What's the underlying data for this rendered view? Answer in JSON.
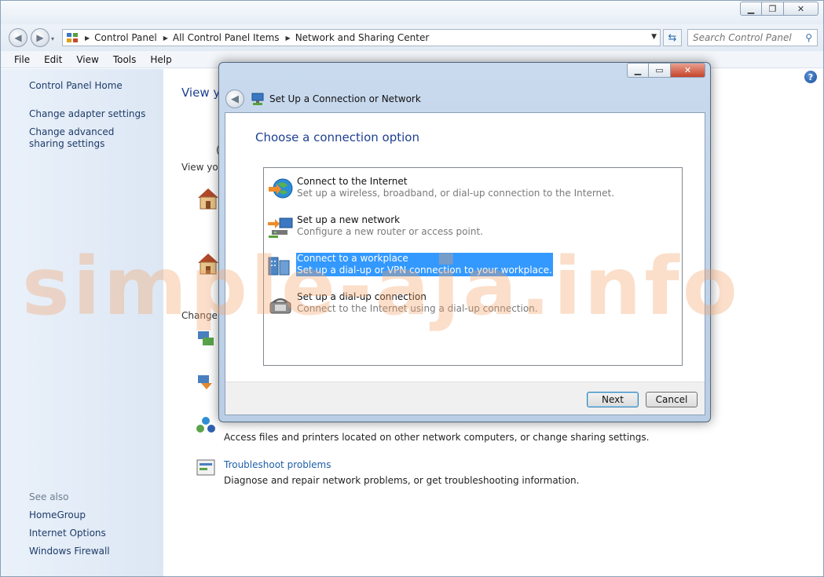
{
  "window": {
    "nav": {
      "crumbs": [
        "Control Panel",
        "All Control Panel Items",
        "Network and Sharing Center"
      ]
    },
    "search": {
      "placeholder": "Search Control Panel"
    },
    "menu": [
      "File",
      "Edit",
      "View",
      "Tools",
      "Help"
    ]
  },
  "sidebar": {
    "home": "Control Panel Home",
    "adapter": "Change adapter settings",
    "advanced": "Change advanced sharing settings",
    "see_also": "See also",
    "homegroup": "HomeGroup",
    "internet_options": "Internet Options",
    "firewall": "Windows Firewall"
  },
  "content": {
    "title_partial": "View y",
    "view_partial": "View you",
    "change_partial": "Change y",
    "paren": "(",
    "homegroup_desc": "Access files and printers located on other network computers, or change sharing settings.",
    "troubleshoot_title": "Troubleshoot problems",
    "troubleshoot_desc": "Diagnose and repair network problems, or get troubleshooting information."
  },
  "dialog": {
    "title": "Set Up a Connection or Network",
    "heading": "Choose a connection option",
    "options": [
      {
        "title": "Connect to the Internet",
        "desc": "Set up a wireless, broadband, or dial-up connection to the Internet.",
        "icon": "globe-icon",
        "selected": false
      },
      {
        "title": "Set up a new network",
        "desc": "Configure a new router or access point.",
        "icon": "network-icon",
        "selected": false
      },
      {
        "title": "Connect to a workplace",
        "desc": "Set up a dial-up or VPN connection to your workplace.",
        "icon": "workplace-icon",
        "selected": true
      },
      {
        "title": "Set up a dial-up connection",
        "desc": "Connect to the Internet using a dial-up connection.",
        "icon": "phone-icon",
        "selected": false
      }
    ],
    "next": "Next",
    "cancel": "Cancel"
  },
  "watermark": "simple-aja.info",
  "colors": {
    "selection": "#3399ff",
    "heading": "#1e3f91",
    "link": "#1e5fa8"
  }
}
